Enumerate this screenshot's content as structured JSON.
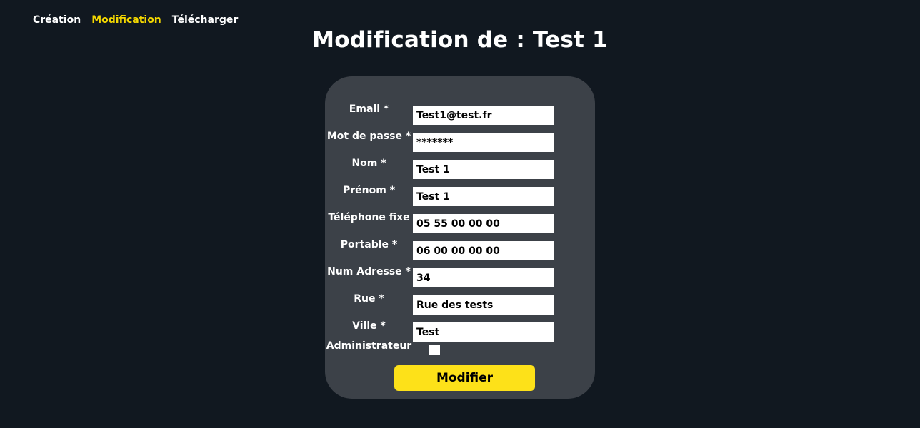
{
  "nav": {
    "items": [
      {
        "label": "Création",
        "active": false
      },
      {
        "label": "Modification",
        "active": true
      },
      {
        "label": "Télécharger",
        "active": false
      }
    ]
  },
  "title": "Modification de : Test 1",
  "form": {
    "fields": [
      {
        "label": "Email *",
        "value": "Test1@test.fr"
      },
      {
        "label": "Mot de passe *",
        "value": "*******"
      },
      {
        "label": "Nom *",
        "value": "Test 1"
      },
      {
        "label": "Prénom *",
        "value": "Test 1"
      },
      {
        "label": "Téléphone fixe",
        "value": "05 55 00 00 00"
      },
      {
        "label": "Portable *",
        "value": "06 00 00 00 00"
      },
      {
        "label": "Num Adresse *",
        "value": "34"
      },
      {
        "label": "Rue *",
        "value": "Rue des tests"
      },
      {
        "label": "Ville *",
        "value": "Test"
      }
    ],
    "admin": {
      "label": "Administrateur",
      "checked": false
    },
    "submit_label": "Modifier"
  },
  "colors": {
    "background": "#111820",
    "card": "#3c4148",
    "accent": "#fde119",
    "active_nav": "#f5d800"
  }
}
